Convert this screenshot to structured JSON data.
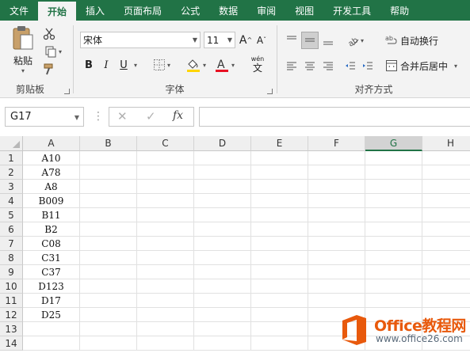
{
  "ribbon_tabs": [
    "文件",
    "开始",
    "插入",
    "页面布局",
    "公式",
    "数据",
    "审阅",
    "视图",
    "开发工具",
    "帮助"
  ],
  "active_tab": "开始",
  "clipboard": {
    "paste_label": "粘贴",
    "group_label": "剪贴板"
  },
  "font": {
    "name": "宋体",
    "size": "11",
    "group_label": "字体",
    "phonetic_label": "wén",
    "bold": "B",
    "italic": "I",
    "underline": "U"
  },
  "alignment": {
    "wrap_label": "自动换行",
    "merge_label": "合并后居中",
    "group_label": "对齐方式"
  },
  "formula_bar": {
    "name_box": "G17",
    "fx": "fx",
    "cancel": "✕",
    "enter": "✓"
  },
  "columns": [
    "A",
    "B",
    "C",
    "D",
    "E",
    "F",
    "G",
    "H"
  ],
  "selected_column": "G",
  "rows": [
    "1",
    "2",
    "3",
    "4",
    "5",
    "6",
    "7",
    "8",
    "9",
    "10",
    "11",
    "12",
    "13",
    "14"
  ],
  "column_a_values": [
    "A10",
    "A78",
    "A8",
    "B009",
    "B11",
    "B2",
    "C08",
    "C31",
    "C37",
    "D123",
    "D17",
    "D25",
    "",
    ""
  ],
  "watermark": {
    "brand": "Office教程网",
    "url": "www.office26.com"
  },
  "colors": {
    "accent": "#217346",
    "watermark_orange": "#e8590c",
    "font_color_bar": "#e81123",
    "highlight_bar": "#ffd500"
  }
}
